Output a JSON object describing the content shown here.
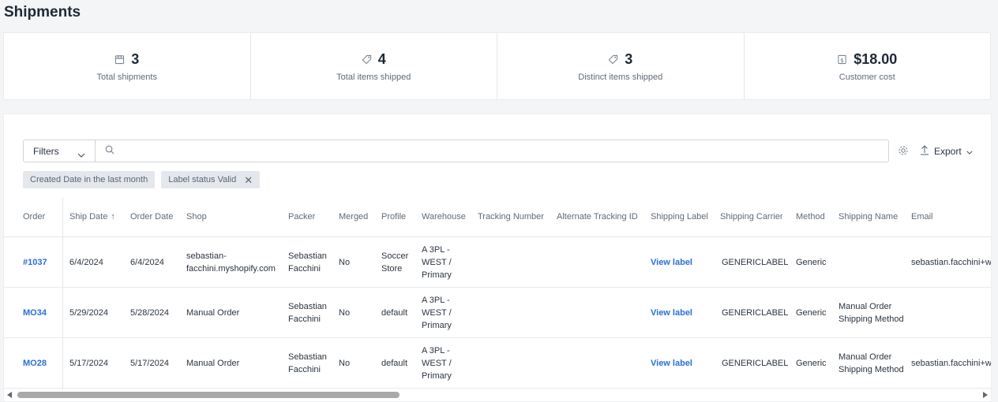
{
  "page": {
    "title": "Shipments"
  },
  "stats": [
    {
      "icon": "box-icon",
      "value": "3",
      "label": "Total shipments"
    },
    {
      "icon": "tag-icon",
      "value": "4",
      "label": "Total items shipped"
    },
    {
      "icon": "tag-icon",
      "value": "3",
      "label": "Distinct items shipped"
    },
    {
      "icon": "dollar-icon",
      "value": "$18.00",
      "label": "Customer cost"
    }
  ],
  "toolbar": {
    "filters_label": "Filters",
    "search_placeholder": "",
    "search_value": "",
    "export_label": "Export"
  },
  "chips": [
    {
      "label": "Created Date in the last month",
      "removable": false
    },
    {
      "label": "Label status Valid",
      "removable": true
    }
  ],
  "table": {
    "columns": [
      "Order",
      "Ship Date",
      "Order Date",
      "Shop",
      "Packer",
      "Merged",
      "Profile",
      "Warehouse",
      "Tracking Number",
      "Alternate Tracking ID",
      "Shipping Label",
      "Shipping Carrier",
      "Method",
      "Shipping Name",
      "Email"
    ],
    "rows": [
      {
        "order": "#1037",
        "ship_date": "6/4/2024",
        "order_date": "6/4/2024",
        "shop": "sebastian-facchini.myshopify.com",
        "packer": "Sebastian Facchini",
        "merged": "No",
        "profile": "Soccer Store",
        "warehouse": "A 3PL - WEST / Primary",
        "tracking": "",
        "alt_tracking": "",
        "label": "View label",
        "carrier": "GENERICLABEL",
        "method": "Generic",
        "shipping_name": "",
        "email": "sebastian.facchini+w"
      },
      {
        "order": "MO34",
        "ship_date": "5/29/2024",
        "order_date": "5/28/2024",
        "shop": "Manual Order",
        "packer": "Sebastian Facchini",
        "merged": "No",
        "profile": "default",
        "warehouse": "A 3PL - WEST / Primary",
        "tracking": "",
        "alt_tracking": "",
        "label": "View label",
        "carrier": "GENERICLABEL",
        "method": "Generic",
        "shipping_name": "Manual Order Shipping Method",
        "email": ""
      },
      {
        "order": "MO28",
        "ship_date": "5/17/2024",
        "order_date": "5/17/2024",
        "shop": "Manual Order",
        "packer": "Sebastian Facchini",
        "merged": "No",
        "profile": "default",
        "warehouse": "A 3PL - WEST / Primary",
        "tracking": "",
        "alt_tracking": "",
        "label": "View label",
        "carrier": "GENERICLABEL",
        "method": "Generic",
        "shipping_name": "Manual Order Shipping Method",
        "email": "sebastian.facchini+w"
      }
    ]
  },
  "colors": {
    "link": "#2a6fd6",
    "title": "#1e2935",
    "muted": "#5f6b78"
  }
}
